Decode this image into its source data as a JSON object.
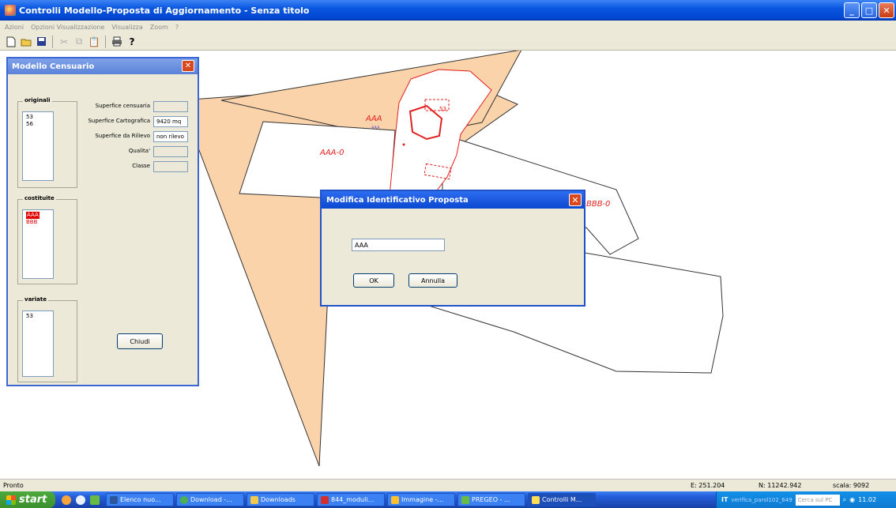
{
  "window": {
    "title": "Controlli Modello-Proposta di Aggiornamento - Senza titolo",
    "minimize": "_",
    "maximize": "□",
    "close": "✕"
  },
  "menu": [
    "Azioni",
    "Opzioni Visualizzazione",
    "Visualizza",
    "Zoom",
    "?"
  ],
  "toolbar": {
    "icons": [
      "new-file-icon",
      "open-folder-icon",
      "save-disk-icon",
      "cut-icon",
      "copy-icon",
      "paste-icon",
      "print-icon",
      "help-icon"
    ]
  },
  "map": {
    "labels": {
      "aaa_top": "AAA",
      "aaa_small": "AAA",
      "aaa0": "AAA-0",
      "bbb0": "BBB-0",
      "s": "53"
    },
    "colors": {
      "fill": "#fad3aa",
      "red": "#e32020"
    }
  },
  "modello": {
    "title": "Modello Censuario",
    "originali_label": "originali",
    "originali": [
      "53",
      "56"
    ],
    "costituite_label": "costituite",
    "costituite": [
      "AAA",
      "BBB"
    ],
    "variate_label": "variate",
    "variate": [
      "53"
    ],
    "fields": [
      {
        "label": "Superfice censuaria",
        "value": ""
      },
      {
        "label": "Superfice Cartografica",
        "value": "9420 mq"
      },
      {
        "label": "Superfice da Rilievo",
        "value": "non rilevo"
      },
      {
        "label": "Qualita'",
        "value": ""
      },
      {
        "label": "Classe",
        "value": ""
      }
    ],
    "close_label": "Chiudi"
  },
  "dialog": {
    "title": "Modifica Identificativo Proposta",
    "input_value": "AAA",
    "ok_label": "OK",
    "cancel_label": "Annulla"
  },
  "status": {
    "text": "Pronto",
    "e": "E: 251.204",
    "n": "N: 11242.942",
    "scala": "scala:  9092"
  },
  "taskbar": {
    "start_label": "start",
    "tasks": [
      "Elenco nuo...",
      "Download -...",
      "Downloads",
      "844_moduli...",
      "Immagine -...",
      "PREGEO - ...",
      "Controlli M..."
    ],
    "tray": {
      "lang": "IT",
      "file": "verifica_parol102_649",
      "search": "Cerca sul PC",
      "clock": "11.02"
    }
  }
}
